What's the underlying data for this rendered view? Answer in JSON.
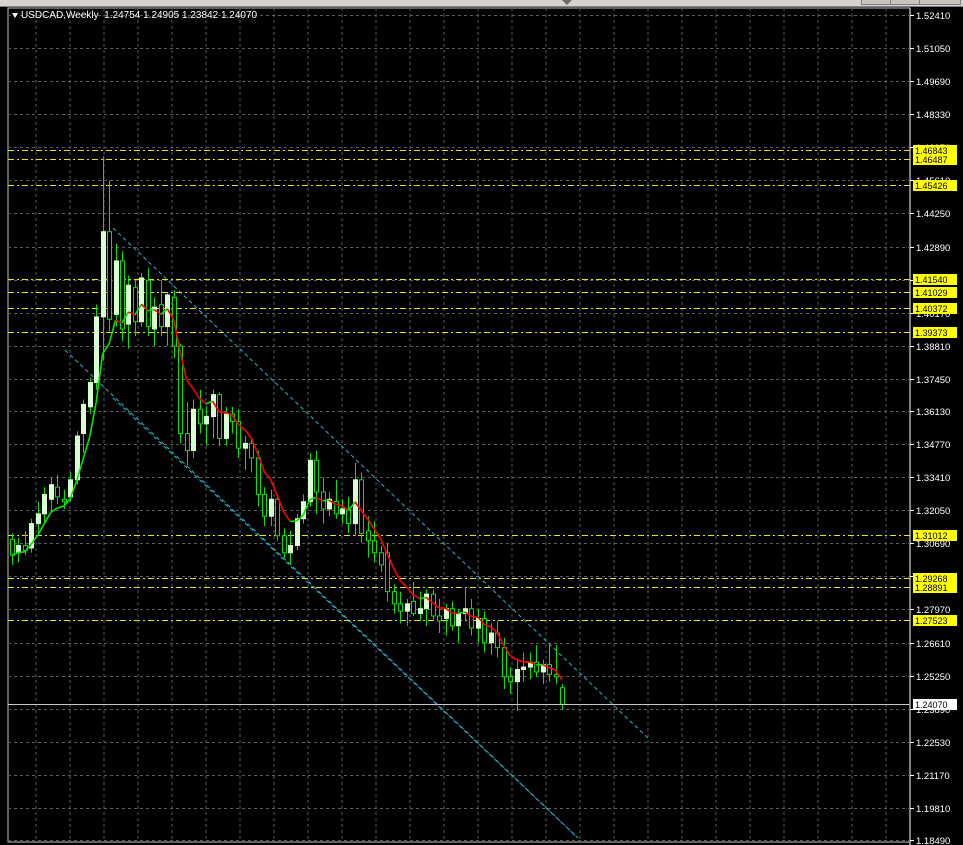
{
  "header": {
    "symbol": "USDCAD,Weekly",
    "ohlc": "1.24754 1.24905 1.23842 1.24070"
  },
  "colors": {
    "background": "#000000",
    "grid": "#5a5a5a",
    "axis_text": "#ffffff",
    "level_line": "#e6e600",
    "level_label_bg": "#ffff00",
    "channel": "#2ab3c9",
    "bull_body": "#d9ffd0",
    "wick": "#00e600",
    "ma_up": "#00e600",
    "ma_down": "#ff0000",
    "price_label_bg": "#ffffff"
  },
  "chart_data": {
    "type": "candlestick",
    "title": "USDCAD,Weekly",
    "y_ticks": [
      "1.52410",
      "1.51050",
      "1.49690",
      "1.48330",
      "1.46970",
      "1.45610",
      "1.44250",
      "1.42890",
      "1.41530",
      "1.40170",
      "1.38810",
      "1.37450",
      "1.36130",
      "1.34770",
      "1.33410",
      "1.32050",
      "1.30690",
      "1.29330",
      "1.27970",
      "1.26610",
      "1.25250",
      "1.23890",
      "1.22530",
      "1.21170",
      "1.19810",
      "1.18490"
    ],
    "ylim": [
      1.1849,
      1.5241
    ],
    "current_price": "1.24070",
    "horizontal_levels": [
      "1.46843",
      "1.46487",
      "1.45426",
      "1.41540",
      "1.41029",
      "1.40372",
      "1.39373",
      "1.31012",
      "1.29268",
      "1.28891",
      "1.27523"
    ],
    "candles": [
      {
        "o": 1.3085,
        "h": 1.311,
        "l": 1.298,
        "c": 1.302
      },
      {
        "o": 1.303,
        "h": 1.309,
        "l": 1.299,
        "c": 1.306
      },
      {
        "o": 1.306,
        "h": 1.312,
        "l": 1.302,
        "c": 1.304
      },
      {
        "o": 1.305,
        "h": 1.317,
        "l": 1.303,
        "c": 1.315
      },
      {
        "o": 1.315,
        "h": 1.324,
        "l": 1.31,
        "c": 1.319
      },
      {
        "o": 1.319,
        "h": 1.33,
        "l": 1.315,
        "c": 1.327
      },
      {
        "o": 1.325,
        "h": 1.334,
        "l": 1.32,
        "c": 1.331
      },
      {
        "o": 1.33,
        "h": 1.335,
        "l": 1.323,
        "c": 1.326
      },
      {
        "o": 1.325,
        "h": 1.329,
        "l": 1.321,
        "c": 1.324
      },
      {
        "o": 1.326,
        "h": 1.336,
        "l": 1.324,
        "c": 1.333
      },
      {
        "o": 1.333,
        "h": 1.353,
        "l": 1.331,
        "c": 1.351
      },
      {
        "o": 1.352,
        "h": 1.366,
        "l": 1.344,
        "c": 1.364
      },
      {
        "o": 1.363,
        "h": 1.375,
        "l": 1.36,
        "c": 1.373
      },
      {
        "o": 1.373,
        "h": 1.405,
        "l": 1.37,
        "c": 1.4
      },
      {
        "o": 1.4,
        "h": 1.466,
        "l": 1.382,
        "c": 1.435
      },
      {
        "o": 1.435,
        "h": 1.456,
        "l": 1.394,
        "c": 1.399
      },
      {
        "o": 1.401,
        "h": 1.43,
        "l": 1.396,
        "c": 1.423
      },
      {
        "o": 1.423,
        "h": 1.427,
        "l": 1.39,
        "c": 1.395
      },
      {
        "o": 1.397,
        "h": 1.417,
        "l": 1.387,
        "c": 1.413
      },
      {
        "o": 1.412,
        "h": 1.415,
        "l": 1.392,
        "c": 1.398
      },
      {
        "o": 1.398,
        "h": 1.418,
        "l": 1.396,
        "c": 1.416
      },
      {
        "o": 1.415,
        "h": 1.42,
        "l": 1.392,
        "c": 1.396
      },
      {
        "o": 1.395,
        "h": 1.408,
        "l": 1.388,
        "c": 1.404
      },
      {
        "o": 1.405,
        "h": 1.415,
        "l": 1.392,
        "c": 1.396
      },
      {
        "o": 1.396,
        "h": 1.41,
        "l": 1.388,
        "c": 1.409
      },
      {
        "o": 1.408,
        "h": 1.411,
        "l": 1.383,
        "c": 1.388
      },
      {
        "o": 1.388,
        "h": 1.389,
        "l": 1.348,
        "c": 1.352
      },
      {
        "o": 1.352,
        "h": 1.365,
        "l": 1.339,
        "c": 1.345
      },
      {
        "o": 1.345,
        "h": 1.366,
        "l": 1.342,
        "c": 1.362
      },
      {
        "o": 1.362,
        "h": 1.37,
        "l": 1.352,
        "c": 1.356
      },
      {
        "o": 1.356,
        "h": 1.363,
        "l": 1.347,
        "c": 1.359
      },
      {
        "o": 1.359,
        "h": 1.37,
        "l": 1.35,
        "c": 1.368
      },
      {
        "o": 1.368,
        "h": 1.369,
        "l": 1.347,
        "c": 1.35
      },
      {
        "o": 1.35,
        "h": 1.363,
        "l": 1.347,
        "c": 1.36
      },
      {
        "o": 1.36,
        "h": 1.363,
        "l": 1.352,
        "c": 1.357
      },
      {
        "o": 1.357,
        "h": 1.362,
        "l": 1.342,
        "c": 1.346
      },
      {
        "o": 1.346,
        "h": 1.351,
        "l": 1.337,
        "c": 1.348
      },
      {
        "o": 1.348,
        "h": 1.35,
        "l": 1.336,
        "c": 1.342
      },
      {
        "o": 1.342,
        "h": 1.345,
        "l": 1.322,
        "c": 1.327
      },
      {
        "o": 1.327,
        "h": 1.33,
        "l": 1.314,
        "c": 1.318
      },
      {
        "o": 1.318,
        "h": 1.329,
        "l": 1.314,
        "c": 1.325
      },
      {
        "o": 1.325,
        "h": 1.327,
        "l": 1.308,
        "c": 1.31
      },
      {
        "o": 1.31,
        "h": 1.313,
        "l": 1.301,
        "c": 1.303
      },
      {
        "o": 1.303,
        "h": 1.312,
        "l": 1.298,
        "c": 1.306
      },
      {
        "o": 1.306,
        "h": 1.319,
        "l": 1.304,
        "c": 1.317
      },
      {
        "o": 1.317,
        "h": 1.327,
        "l": 1.315,
        "c": 1.324
      },
      {
        "o": 1.324,
        "h": 1.344,
        "l": 1.322,
        "c": 1.341
      },
      {
        "o": 1.341,
        "h": 1.345,
        "l": 1.319,
        "c": 1.328
      },
      {
        "o": 1.328,
        "h": 1.334,
        "l": 1.315,
        "c": 1.321
      },
      {
        "o": 1.321,
        "h": 1.328,
        "l": 1.318,
        "c": 1.325
      },
      {
        "o": 1.324,
        "h": 1.333,
        "l": 1.317,
        "c": 1.319
      },
      {
        "o": 1.319,
        "h": 1.325,
        "l": 1.315,
        "c": 1.321
      },
      {
        "o": 1.321,
        "h": 1.326,
        "l": 1.311,
        "c": 1.315
      },
      {
        "o": 1.315,
        "h": 1.34,
        "l": 1.31,
        "c": 1.333
      },
      {
        "o": 1.333,
        "h": 1.336,
        "l": 1.307,
        "c": 1.311
      },
      {
        "o": 1.312,
        "h": 1.318,
        "l": 1.301,
        "c": 1.308
      },
      {
        "o": 1.308,
        "h": 1.316,
        "l": 1.299,
        "c": 1.303
      },
      {
        "o": 1.303,
        "h": 1.306,
        "l": 1.295,
        "c": 1.298
      },
      {
        "o": 1.303,
        "h": 1.307,
        "l": 1.283,
        "c": 1.287
      },
      {
        "o": 1.287,
        "h": 1.29,
        "l": 1.278,
        "c": 1.282
      },
      {
        "o": 1.282,
        "h": 1.287,
        "l": 1.274,
        "c": 1.279
      },
      {
        "o": 1.279,
        "h": 1.284,
        "l": 1.273,
        "c": 1.282
      },
      {
        "o": 1.283,
        "h": 1.291,
        "l": 1.277,
        "c": 1.278
      },
      {
        "o": 1.278,
        "h": 1.287,
        "l": 1.275,
        "c": 1.28
      },
      {
        "o": 1.28,
        "h": 1.288,
        "l": 1.273,
        "c": 1.286
      },
      {
        "o": 1.286,
        "h": 1.288,
        "l": 1.275,
        "c": 1.277
      },
      {
        "o": 1.277,
        "h": 1.284,
        "l": 1.27,
        "c": 1.275
      },
      {
        "o": 1.276,
        "h": 1.282,
        "l": 1.269,
        "c": 1.28
      },
      {
        "o": 1.28,
        "h": 1.283,
        "l": 1.271,
        "c": 1.273
      },
      {
        "o": 1.273,
        "h": 1.28,
        "l": 1.266,
        "c": 1.278
      },
      {
        "o": 1.278,
        "h": 1.289,
        "l": 1.275,
        "c": 1.28
      },
      {
        "o": 1.28,
        "h": 1.284,
        "l": 1.269,
        "c": 1.272
      },
      {
        "o": 1.272,
        "h": 1.28,
        "l": 1.266,
        "c": 1.276
      },
      {
        "o": 1.276,
        "h": 1.279,
        "l": 1.262,
        "c": 1.266
      },
      {
        "o": 1.266,
        "h": 1.274,
        "l": 1.261,
        "c": 1.27
      },
      {
        "o": 1.27,
        "h": 1.275,
        "l": 1.26,
        "c": 1.264
      },
      {
        "o": 1.264,
        "h": 1.268,
        "l": 1.247,
        "c": 1.252
      },
      {
        "o": 1.252,
        "h": 1.256,
        "l": 1.245,
        "c": 1.25
      },
      {
        "o": 1.25,
        "h": 1.259,
        "l": 1.238,
        "c": 1.255
      },
      {
        "o": 1.255,
        "h": 1.262,
        "l": 1.25,
        "c": 1.256
      },
      {
        "o": 1.256,
        "h": 1.262,
        "l": 1.251,
        "c": 1.258
      },
      {
        "o": 1.258,
        "h": 1.265,
        "l": 1.252,
        "c": 1.254
      },
      {
        "o": 1.254,
        "h": 1.259,
        "l": 1.249,
        "c": 1.257
      },
      {
        "o": 1.257,
        "h": 1.266,
        "l": 1.25,
        "c": 1.253
      },
      {
        "o": 1.253,
        "h": 1.265,
        "l": 1.249,
        "c": 1.252
      },
      {
        "o": 1.2475,
        "h": 1.2491,
        "l": 1.2384,
        "c": 1.2407
      }
    ]
  }
}
